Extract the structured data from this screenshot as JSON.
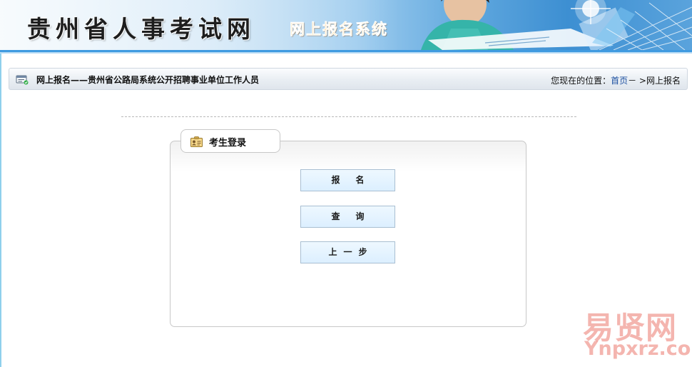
{
  "header": {
    "site_title": "贵州省人事考试网",
    "system_title": "网上报名系统"
  },
  "breadcrumb": {
    "title": "网上报名——贵州省公路局系统公开招聘事业单位工作人员",
    "location_label": "您现在的位置：",
    "home_link": "首页",
    "separator": "－ >",
    "current": "网上报名"
  },
  "login_panel": {
    "tab_label": "考生登录",
    "buttons": {
      "register": "报名",
      "query": "查询",
      "back": "上一步"
    }
  },
  "watermark": {
    "cn": "易贤网",
    "en": "Ynpxrz.com"
  },
  "colors": {
    "banner_line": "#3f9ae0",
    "link": "#1b4fa0",
    "subtitle": "#ffb020",
    "button_bg": "#dcefff",
    "watermark": "#eb786e"
  }
}
